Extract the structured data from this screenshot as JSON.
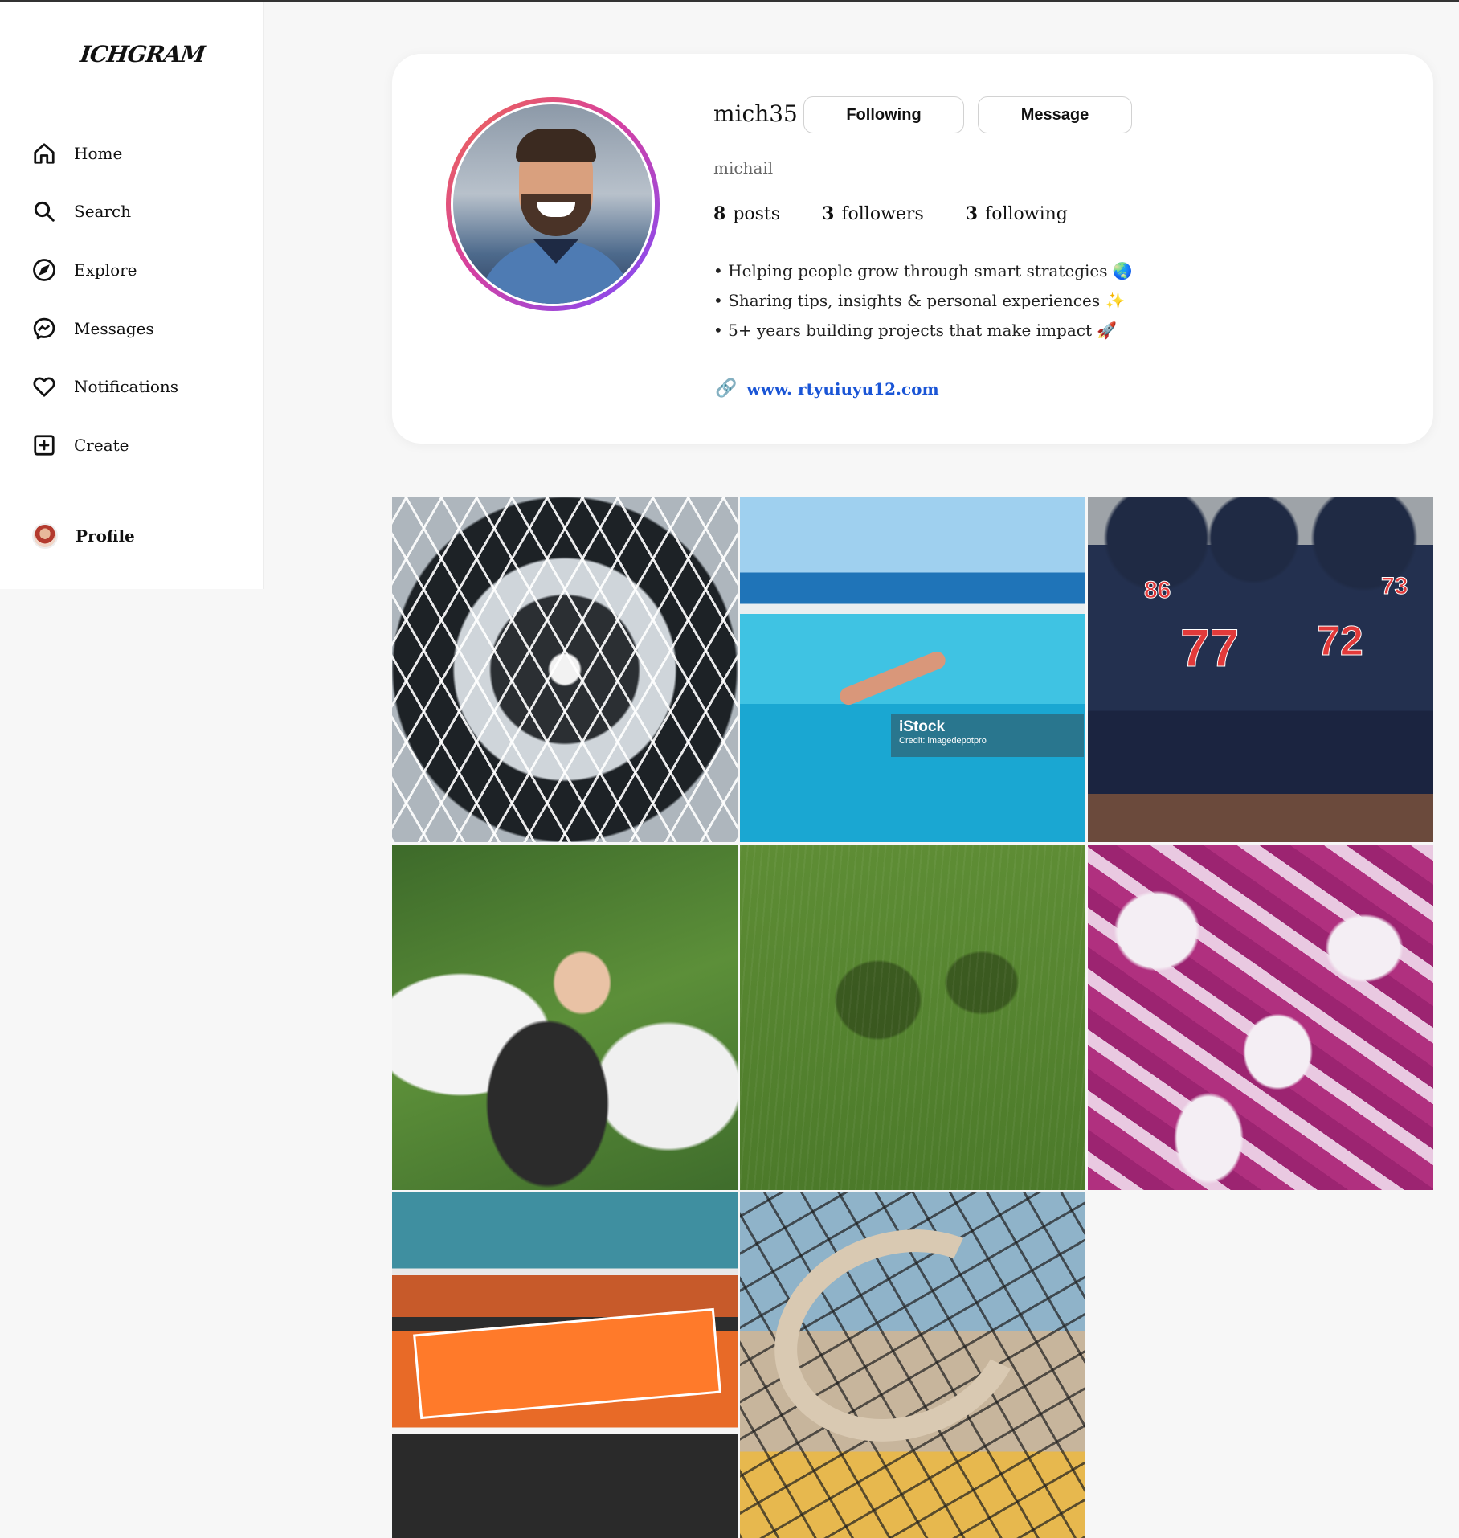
{
  "app": {
    "logo_text": "ICHGRAM"
  },
  "sidebar": {
    "items": [
      {
        "label": "Home",
        "icon": "home-icon"
      },
      {
        "label": "Search",
        "icon": "search-icon"
      },
      {
        "label": "Explore",
        "icon": "compass-icon"
      },
      {
        "label": "Messages",
        "icon": "messenger-icon"
      },
      {
        "label": "Notifications",
        "icon": "heart-icon"
      },
      {
        "label": "Create",
        "icon": "plus-square-icon"
      }
    ],
    "profile_label": "Profile"
  },
  "profile": {
    "username": "mich35",
    "following_button": "Following",
    "message_button": "Message",
    "full_name": "michail",
    "stats": {
      "posts_count": "8",
      "posts_label": "posts",
      "followers_count": "3",
      "followers_label": "followers",
      "following_count": "3",
      "following_label": "following"
    },
    "bio": [
      "• Helping people grow through smart strategies 🌏",
      "• Sharing tips, insights & personal experiences ✨",
      "• 5+ years building projects that make impact 🚀"
    ],
    "website": "www. rtyuiuyu12.com",
    "link_icon": "🔗"
  },
  "posts": {
    "watermark_brand": "iStock",
    "watermark_credit": "Credit: imagedepotpro",
    "jersey_numbers": [
      "86",
      "77",
      "72",
      "73"
    ]
  },
  "colors": {
    "link": "#1a55d6",
    "avatar_ring_start": "#f06a4e",
    "avatar_ring_end": "#7b4dff"
  }
}
